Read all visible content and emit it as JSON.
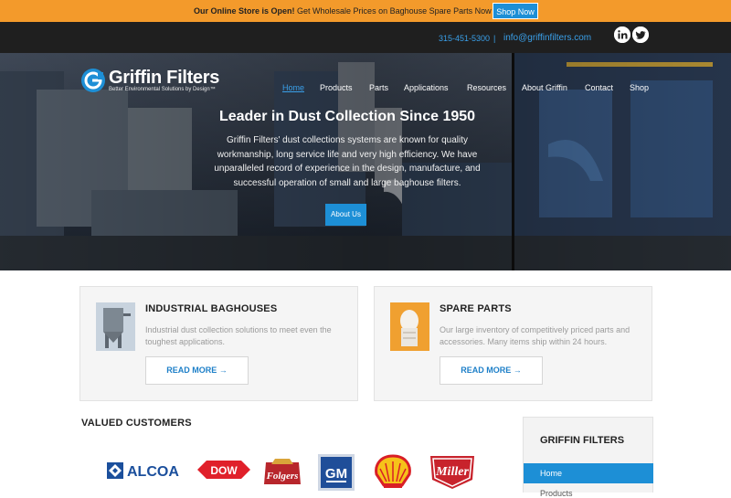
{
  "promo": {
    "bold": "Our Online Store is Open!",
    "rest": "Get Wholesale Prices on Baghouse Spare Parts Now",
    "button": "Shop Now"
  },
  "contact": {
    "phone": "315-451-5300",
    "separator": "|",
    "email": "info@griffinfilters.com",
    "social": [
      "linkedin-icon",
      "twitter-icon"
    ]
  },
  "brand": {
    "name": "Griffin Filters",
    "tagline": "Better Environmental Solutions by Design™"
  },
  "nav": [
    "Home",
    "Products",
    "Parts",
    "Applications",
    "Resources",
    "About Griffin",
    "Contact",
    "Shop"
  ],
  "hero": {
    "title": "Leader in Dust Collection Since 1950",
    "body": "Griffin Filters' dust collections systems are known for quality workmanship, long service life and very high efficiency. We have unparalleled record of experience in the design, manufacture, and successful operation of small and large baghouse filters.",
    "button": "About Us"
  },
  "cards": [
    {
      "title": "INDUSTRIAL BAGHOUSES",
      "desc": "Industrial dust collection solutions to meet even the toughest applications.",
      "button": "READ MORE →"
    },
    {
      "title": "SPARE PARTS",
      "desc": "Our large inventory of competitively priced parts and accessories. Many items ship within 24 hours.",
      "button": "READ MORE →"
    }
  ],
  "customers": {
    "title": "VALUED CUSTOMERS",
    "logos": [
      "ALCOA",
      "DOW",
      "Folgers",
      "GM",
      "Shell",
      "Miller"
    ]
  },
  "sidebar": {
    "title": "GRIFFIN FILTERS",
    "items": [
      "Home",
      "Products"
    ]
  },
  "colors": {
    "accent": "#1d8fd6",
    "promo": "#f39a2b",
    "topbar": "#1f1f1f",
    "link": "#3aa0ea"
  }
}
